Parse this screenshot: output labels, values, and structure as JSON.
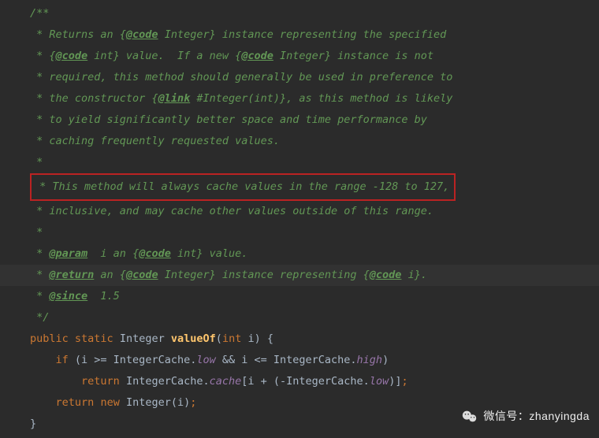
{
  "javadoc": {
    "open": "/**",
    "l1": " * Returns an {",
    "l1_tag": "@code",
    "l1b": " Integer} instance representing the specified",
    "l2a": " * {",
    "l2_tag": "@code",
    "l2b": " int} value.  If a new {",
    "l2_tag2": "@code",
    "l2c": " Integer} instance is not",
    "l3": " * required, this method should generally be used in preference to",
    "l4a": " * the constructor {",
    "l4_tag": "@link",
    "l4b": " #Integer(int)}, as this method is likely",
    "l5": " * to yield significantly better space and time performance by",
    "l6": " * caching frequently requested values.",
    "l7": " *",
    "l8": " * This method will always cache values in the range -128 to 127,",
    "l9": " * inclusive, and may cache other values outside of this range.",
    "l10": " *",
    "l11a": " * ",
    "l11_tag": "@param",
    "l11b": "  i an {",
    "l11_tag2": "@code",
    "l11c": " int} value.",
    "l12a": " * ",
    "l12_tag": "@return",
    "l12b": " an {",
    "l12_tag2": "@code",
    "l12c": " Integer} instance representing {",
    "l12_tag3": "@code",
    "l12d": " i}.",
    "l13a": " * ",
    "l13_tag": "@since",
    "l13b": "  1.5",
    "close": " */"
  },
  "code": {
    "sig_public": "public",
    "sig_static": "static",
    "sig_ret": "Integer",
    "sig_name": "valueOf",
    "sig_paren_open": "(",
    "sig_param_type": "int",
    "sig_param_name": " i",
    "sig_paren_close": ")",
    "brace_open": " {",
    "if_kw": "if",
    "if_open": " (i >= IntegerCache.",
    "low": "low",
    "and": " && i <= IntegerCache.",
    "high": "high",
    "if_close": ")",
    "ret1_kw": "return",
    "ret1_body_a": " IntegerCache.",
    "cache": "cache",
    "ret1_body_b": "[i + (-IntegerCache.",
    "ret1_body_c": ")]",
    "semi": ";",
    "ret2_kw": "return",
    "new_kw": "new",
    "ret2_body": " Integer(i)",
    "brace_close": "}"
  },
  "watermark": {
    "label": "微信号：zhanyingda"
  }
}
